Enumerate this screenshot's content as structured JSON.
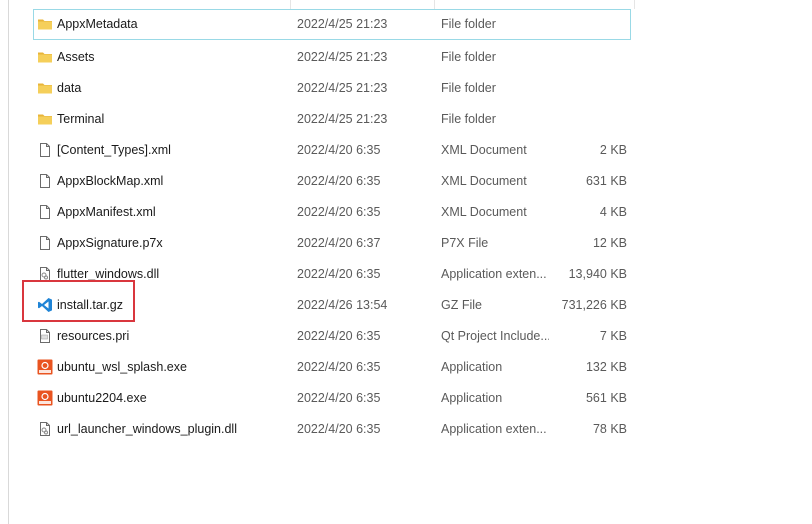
{
  "files": [
    {
      "name": "AppxMetadata",
      "date": "2022/4/25 21:23",
      "type": "File folder",
      "size": "",
      "icon": "folder-icon"
    },
    {
      "name": "Assets",
      "date": "2022/4/25 21:23",
      "type": "File folder",
      "size": "",
      "icon": "folder-icon"
    },
    {
      "name": "data",
      "date": "2022/4/25 21:23",
      "type": "File folder",
      "size": "",
      "icon": "folder-icon"
    },
    {
      "name": "Terminal",
      "date": "2022/4/25 21:23",
      "type": "File folder",
      "size": "",
      "icon": "folder-icon"
    },
    {
      "name": "[Content_Types].xml",
      "date": "2022/4/20 6:35",
      "type": "XML Document",
      "size": "2 KB",
      "icon": "document-icon"
    },
    {
      "name": "AppxBlockMap.xml",
      "date": "2022/4/20 6:35",
      "type": "XML Document",
      "size": "631 KB",
      "icon": "document-icon"
    },
    {
      "name": "AppxManifest.xml",
      "date": "2022/4/20 6:35",
      "type": "XML Document",
      "size": "4 KB",
      "icon": "document-icon"
    },
    {
      "name": "AppxSignature.p7x",
      "date": "2022/4/20 6:37",
      "type": "P7X File",
      "size": "12 KB",
      "icon": "document-icon"
    },
    {
      "name": "flutter_windows.dll",
      "date": "2022/4/20 6:35",
      "type": "Application exten...",
      "size": "13,940 KB",
      "icon": "dll-icon"
    },
    {
      "name": "install.tar.gz",
      "date": "2022/4/26 13:54",
      "type": "GZ File",
      "size": "731,226 KB",
      "icon": "vscode-icon"
    },
    {
      "name": "resources.pri",
      "date": "2022/4/20 6:35",
      "type": "Qt Project Include...",
      "size": "7 KB",
      "icon": "pri-file-icon"
    },
    {
      "name": "ubuntu_wsl_splash.exe",
      "date": "2022/4/20 6:35",
      "type": "Application",
      "size": "132 KB",
      "icon": "ubuntu-app-icon"
    },
    {
      "name": "ubuntu2204.exe",
      "date": "2022/4/20 6:35",
      "type": "Application",
      "size": "561 KB",
      "icon": "ubuntu-app-icon"
    },
    {
      "name": "url_launcher_windows_plugin.dll",
      "date": "2022/4/20 6:35",
      "type": "Application exten...",
      "size": "78 KB",
      "icon": "dll-icon"
    }
  ],
  "selected_index": 0,
  "highlighted_index": 9,
  "colors": {
    "folder": "#f2c94c",
    "selection_border": "#99d9e6",
    "highlight": "#d9363e",
    "vscode": "#1f84d6",
    "ubuntu": "#e95420"
  }
}
